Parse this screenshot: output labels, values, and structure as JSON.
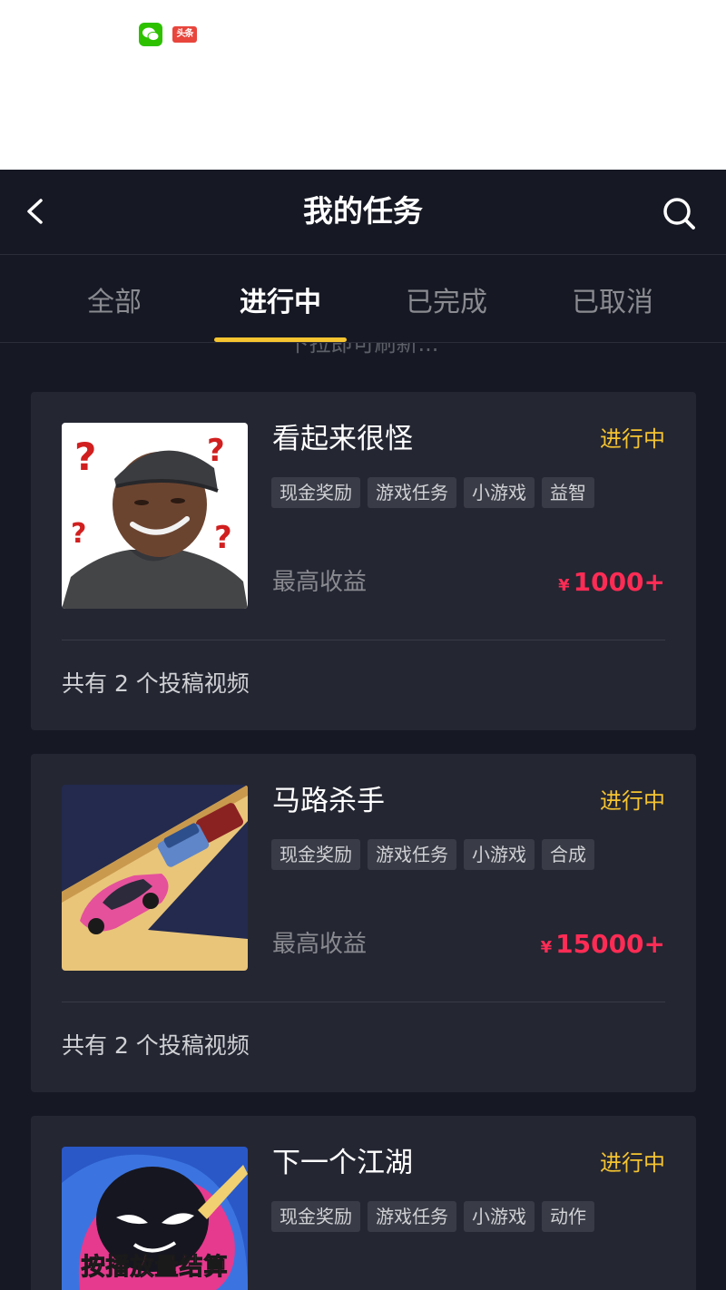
{
  "status_bar": {
    "apps": [
      {
        "name": "wechat-icon",
        "color": "#2dc100"
      },
      {
        "name": "toutiao-icon",
        "label": "头条",
        "color": "#e8453c"
      }
    ]
  },
  "header": {
    "title": "我的任务",
    "back_icon": "chevron-left-icon",
    "search_icon": "search-icon"
  },
  "tabs": [
    {
      "label": "全部",
      "active": false
    },
    {
      "label": "进行中",
      "active": true
    },
    {
      "label": "已完成",
      "active": false
    },
    {
      "label": "已取消",
      "active": false
    }
  ],
  "refresh_hint": "下拉即可刷新...",
  "colors": {
    "background": "#161823",
    "card": "#242632",
    "accent_yellow": "#f5c430",
    "price_red": "#fe2c55"
  },
  "tasks": [
    {
      "title": "看起来很怪",
      "status": "进行中",
      "tags": [
        "现金奖励",
        "游戏任务",
        "小游戏",
        "益智"
      ],
      "earn_label": "最高收益",
      "currency": "¥",
      "amount": "1000+",
      "videos": "共有 2 个投稿视频"
    },
    {
      "title": "马路杀手",
      "status": "进行中",
      "tags": [
        "现金奖励",
        "游戏任务",
        "小游戏",
        "合成"
      ],
      "earn_label": "最高收益",
      "currency": "¥",
      "amount": "15000+",
      "videos": "共有 2 个投稿视频"
    },
    {
      "title": "下一个江湖",
      "status": "进行中",
      "tags": [
        "现金奖励",
        "游戏任务",
        "小游戏",
        "动作"
      ],
      "thumb_caption": "按播放量结算"
    }
  ]
}
